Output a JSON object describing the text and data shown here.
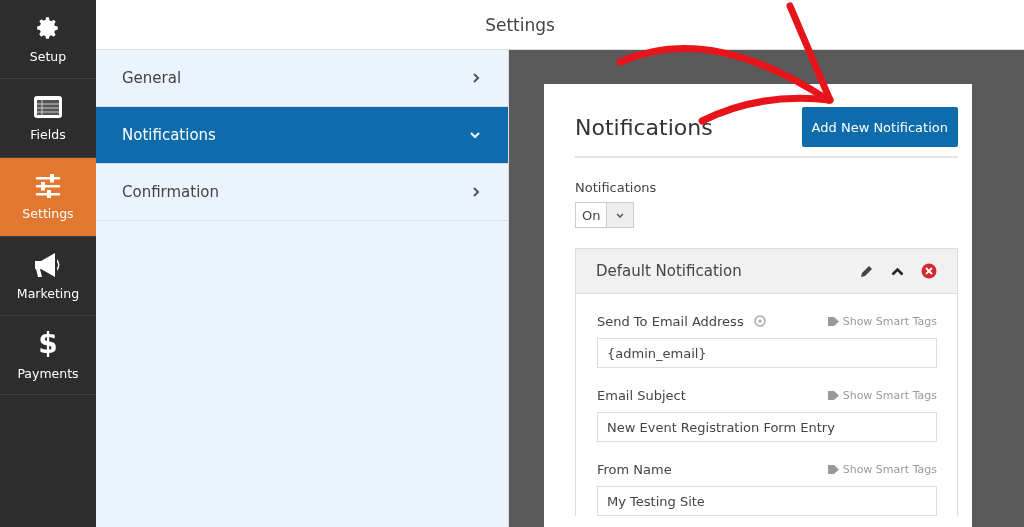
{
  "sidebar": {
    "items": [
      {
        "label": "Setup",
        "kind": "gear",
        "selected": false
      },
      {
        "label": "Fields",
        "kind": "fields",
        "selected": false
      },
      {
        "label": "Settings",
        "kind": "sliders",
        "selected": true
      },
      {
        "label": "Marketing",
        "kind": "megaphone",
        "selected": false
      },
      {
        "label": "Payments",
        "kind": "glyph",
        "glyph": "$",
        "selected": false
      }
    ]
  },
  "header": {
    "title": "Settings"
  },
  "settings_nav": {
    "items": [
      {
        "label": "General",
        "selected": false,
        "expanded": false
      },
      {
        "label": "Notifications",
        "selected": true,
        "expanded": true
      },
      {
        "label": "Confirmation",
        "selected": false,
        "expanded": false
      }
    ]
  },
  "panel": {
    "title": "Notifications",
    "add_button": "Add New Notification",
    "toggle": {
      "label": "Notifications",
      "value": "On"
    },
    "notification": {
      "title": "Default Notification",
      "fields": [
        {
          "label": "Send To Email Address",
          "help": true,
          "smart_tags": "Show Smart Tags",
          "value": "{admin_email}"
        },
        {
          "label": "Email Subject",
          "help": false,
          "smart_tags": "Show Smart Tags",
          "value": "New Event Registration Form Entry"
        },
        {
          "label": "From Name",
          "help": false,
          "smart_tags": "Show Smart Tags",
          "value": "My Testing Site"
        }
      ]
    }
  }
}
